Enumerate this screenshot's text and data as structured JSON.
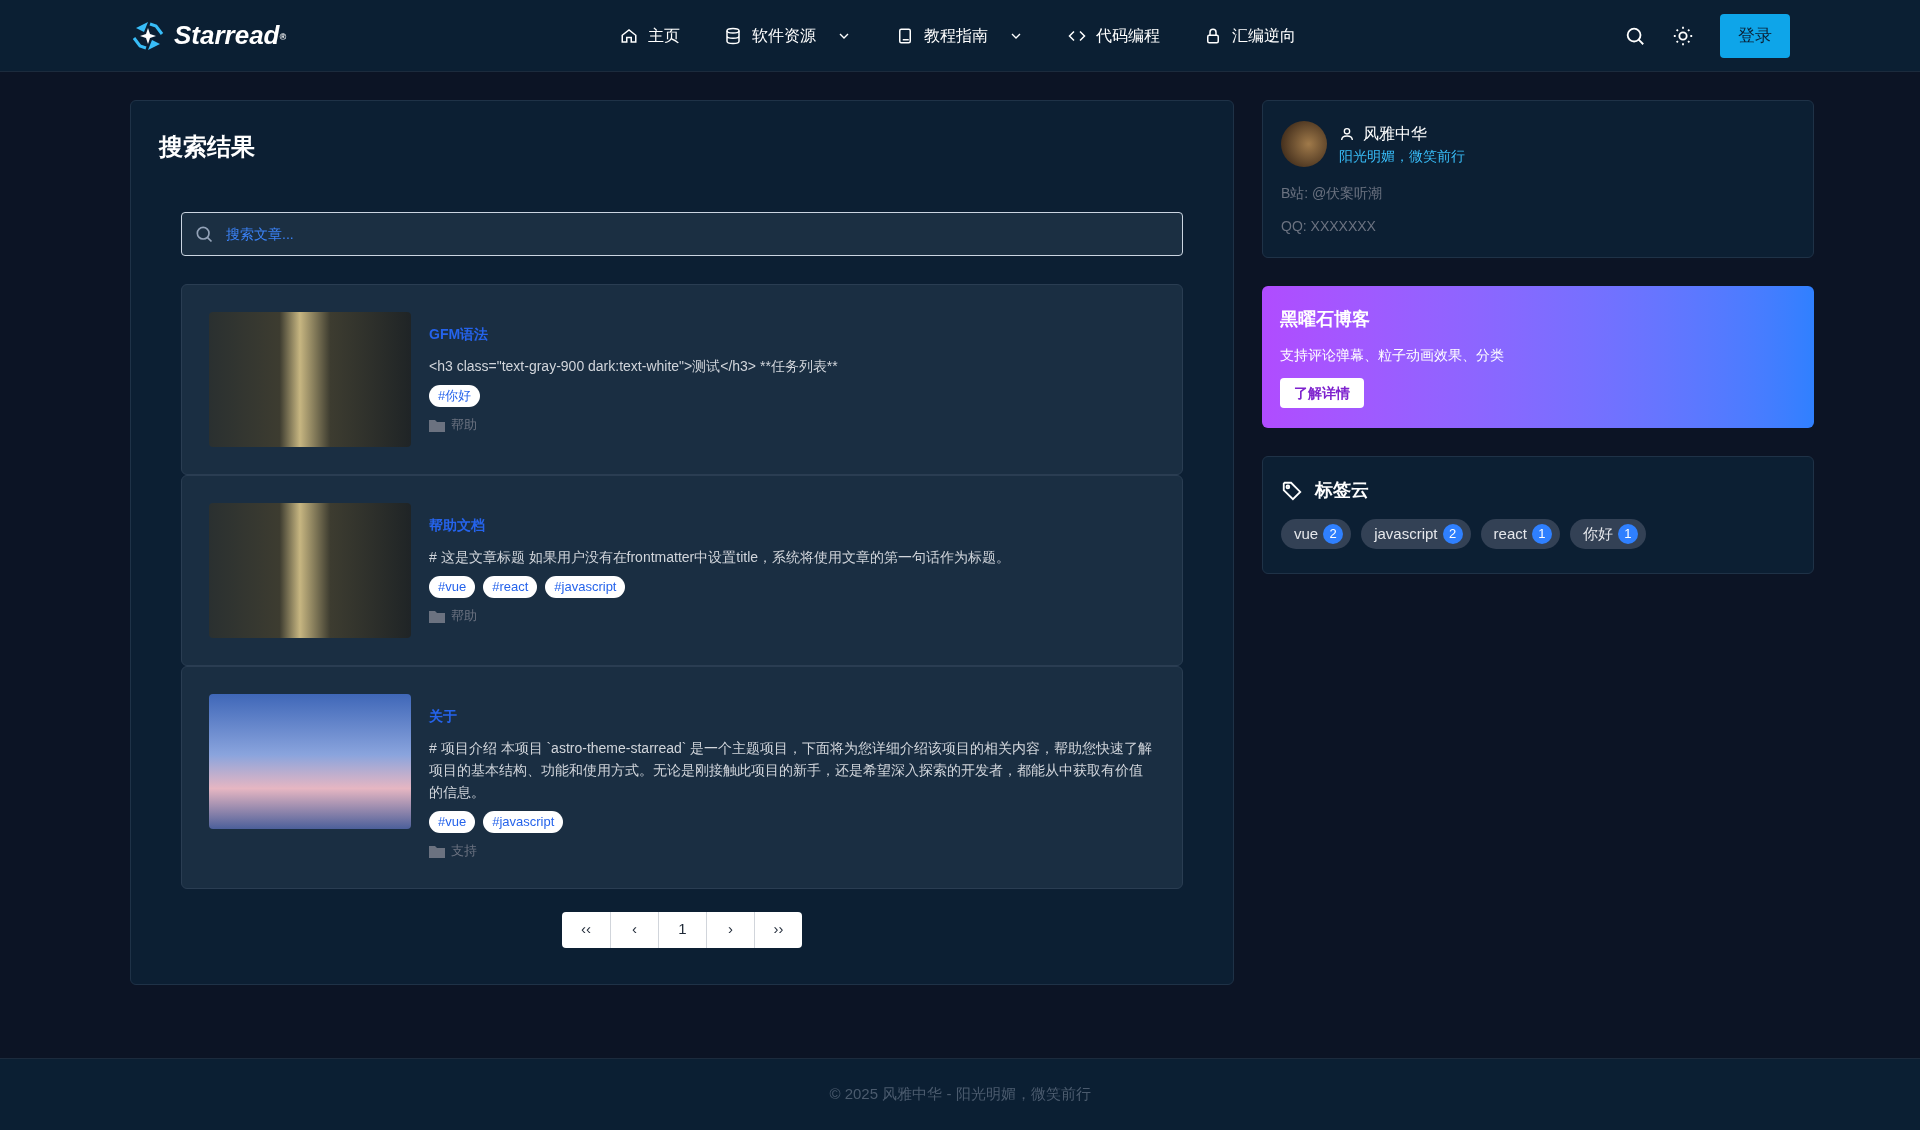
{
  "header": {
    "logo": "Starread",
    "logo_mark": "®",
    "nav": [
      {
        "label": "主页",
        "dropdown": false
      },
      {
        "label": "软件资源",
        "dropdown": true
      },
      {
        "label": "教程指南",
        "dropdown": true
      },
      {
        "label": "代码编程",
        "dropdown": false
      },
      {
        "label": "汇编逆向",
        "dropdown": false
      }
    ],
    "login": "登录"
  },
  "main": {
    "title": "搜索结果",
    "search": {
      "placeholder": "搜索文章..."
    },
    "articles": [
      {
        "title": "GFM语法",
        "excerpt": "<h3 class=\"text-gray-900 dark:text-white\">测试</h3> **任务列表**",
        "tags": [
          "#你好"
        ],
        "category": "帮助"
      },
      {
        "title": "帮助文档",
        "excerpt": "# 这是文章标题 如果用户没有在frontmatter中设置title，系统将使用文章的第一句话作为标题。",
        "tags": [
          "#vue",
          "#react",
          "#javascript"
        ],
        "category": "帮助"
      },
      {
        "title": "关于",
        "excerpt": "# 项目介绍 本项目 `astro-theme-starread` 是一个主题项目，下面将为您详细介绍该项目的相关内容，帮助您快速了解项目的基本结构、功能和使用方式。无论是刚接触此项目的新手，还是希望深入探索的开发者，都能从中获取有价值的信息。",
        "tags": [
          "#vue",
          "#javascript"
        ],
        "category": "支持"
      }
    ],
    "pagination": [
      "‹‹",
      "‹",
      "1",
      "›",
      "››"
    ]
  },
  "sidebar": {
    "profile": {
      "name": "风雅中华",
      "motto": "阳光明媚，微笑前行",
      "lines": [
        "B站: @伏案听潮",
        "QQ: XXXXXXX"
      ]
    },
    "promo": {
      "title": "黑曜石博客",
      "text": "支持评论弹幕、粒子动画效果、分类",
      "button": "了解详情"
    },
    "tag_cloud": {
      "title": "标签云",
      "tags": [
        {
          "name": "vue",
          "count": "2"
        },
        {
          "name": "javascript",
          "count": "2"
        },
        {
          "name": "react",
          "count": "1"
        },
        {
          "name": "你好",
          "count": "1"
        }
      ]
    }
  },
  "footer": "© 2025 风雅中华 - 阳光明媚，微笑前行"
}
